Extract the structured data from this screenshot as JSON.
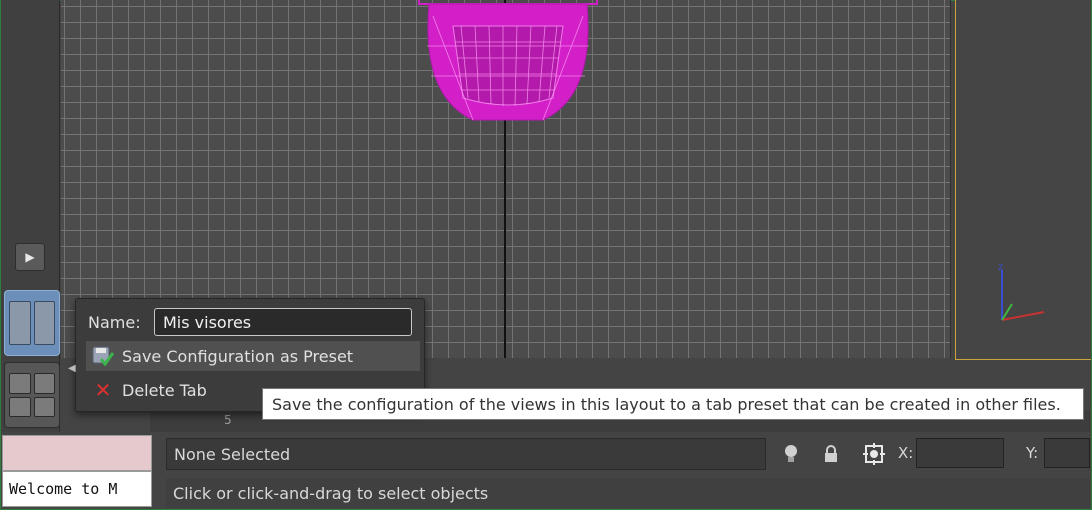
{
  "menu": {
    "name_label": "Name:",
    "name_value": "Mis visores",
    "save_label": "Save Configuration as Preset",
    "delete_label": "Delete Tab"
  },
  "tooltip": {
    "text": "Save the configuration of the views in this layout to a tab preset that can be created in other files."
  },
  "ruler": {
    "visible_numbers": [
      "5"
    ]
  },
  "status": {
    "selection": "None Selected",
    "prompt": "Click or click-and-drag to select objects",
    "x_label": "X:",
    "y_label": "Y:"
  },
  "listener": {
    "output_text": "Welcome to M"
  },
  "icons": {
    "play": "play-icon",
    "bulb": "light-bulb-icon",
    "lock": "lock-icon",
    "snap": "selection-snap-icon"
  },
  "colors": {
    "mesh": "#d21fc8",
    "active_tab": "#6b8fb8",
    "viewport_border": "#c9a43a",
    "delete_icon": "#e03030"
  }
}
